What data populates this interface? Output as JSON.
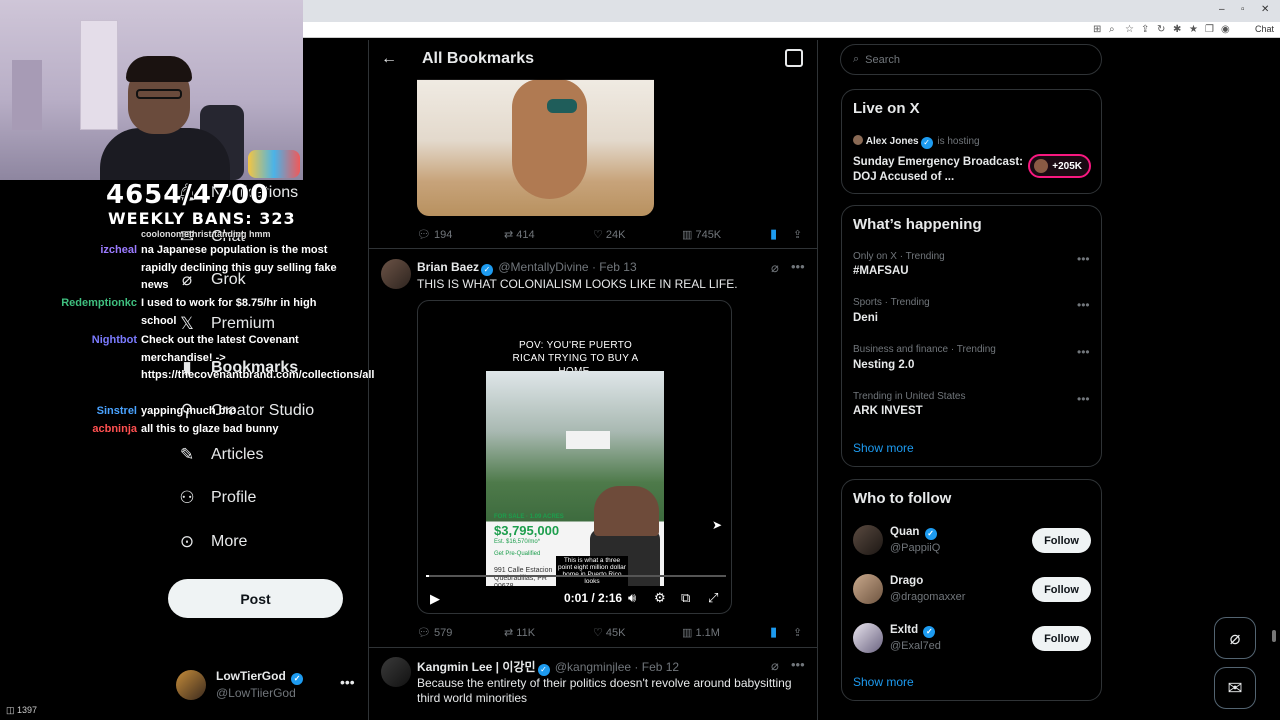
{
  "overlay": {
    "counter": "4654/4700",
    "weekly_bans": "WEEKLY BANS: 323",
    "viewers": "1397"
  },
  "nav": {
    "items": [
      {
        "label": "Notifications",
        "icon": "bell-icon"
      },
      {
        "label": "Chat",
        "icon": "chat-icon"
      },
      {
        "label": "Grok",
        "icon": "grok-icon"
      },
      {
        "label": "Premium",
        "icon": "x-logo-icon"
      },
      {
        "label": "Bookmarks",
        "icon": "bookmark-icon"
      },
      {
        "label": "Creator Studio",
        "icon": "creator-studio-icon"
      },
      {
        "label": "Articles",
        "icon": "article-icon"
      },
      {
        "label": "Profile",
        "icon": "profile-icon"
      },
      {
        "label": "More",
        "icon": "more-circle-icon"
      }
    ],
    "post_label": "Post",
    "account": {
      "name": "LowTierGod",
      "handle": "@LowTiierGod"
    }
  },
  "chat": [
    {
      "user": "",
      "user_color": "#e05555",
      "msg": "coolonomethrist tanding hmm"
    },
    {
      "user": "izcheal",
      "user_color": "#9b7bff",
      "msg": "na Japanese population is the most rapidly declining this guy selling fake news"
    },
    {
      "user": "Redemptionkc",
      "user_color": "#3fbf7f",
      "msg": "I used to work for $8.75/hr in high school"
    },
    {
      "user": "Nightbot",
      "user_color": "#7b7bff",
      "msg": "Check out the latest Covenant merchandise! -> https://thecovenantbrand.com/collections/all"
    },
    {
      "user": "Sinstrel",
      "user_color": "#4aa3ff",
      "msg": "yapping much bro"
    },
    {
      "user": "acbninja",
      "user_color": "#ff5050",
      "msg": "all this to glaze bad bunny"
    }
  ],
  "middle": {
    "title": "All Bookmarks",
    "tweet1_stats": {
      "replies": "194",
      "reposts": "414",
      "likes": "24K",
      "views": "745K"
    },
    "tweet2": {
      "name": "Brian Baez",
      "handle": "@MentallyDivine",
      "date": "Feb 13",
      "text": "THIS IS WHAT COLONIALISM LOOKS LIKE IN REAL LIFE.",
      "video": {
        "caption": "POV: YOU'RE PUERTO RICAN TRYING TO BUY A HOME.",
        "for_sale": "FOR SALE · 1.09 ACRES",
        "price": "$3,795,000",
        "est": "Est. $16,570/mo*",
        "prequal": "Get Pre-Qualified",
        "address": "991 Calle Estacion Quebradillas, PR 00678",
        "subtitle": "This is what a three point eight million dollar home in Puerto Rico looks",
        "time": "0:01 / 2:16",
        "progress": 0.01
      },
      "stats": {
        "replies": "579",
        "reposts": "11K",
        "likes": "45K",
        "views": "1.1M"
      }
    },
    "tweet3": {
      "name": "Kangmin Lee | 이강민",
      "handle": "@kangminjlee",
      "date": "Feb 12",
      "text": "Because the entirety of their politics doesn't revolve around babysitting third world minorities"
    }
  },
  "right": {
    "search_placeholder": "Search",
    "live": {
      "title": "Live on X",
      "host": "Alex Jones",
      "hosting": "is hosting",
      "event": "Sunday Emergency Broadcast: DOJ Accused of ...",
      "listeners": "+205K"
    },
    "happening": {
      "title": "What’s happening",
      "trends": [
        {
          "context": "Only on X · Trending",
          "topic": "#MAFSAU"
        },
        {
          "context": "Sports · Trending",
          "topic": "Deni"
        },
        {
          "context": "Business and finance · Trending",
          "topic": "Nesting 2.0"
        },
        {
          "context": "Trending in United States",
          "topic": "ARK INVEST"
        }
      ],
      "show_more": "Show more"
    },
    "who_to_follow": {
      "title": "Who to follow",
      "accounts": [
        {
          "name": "Quan",
          "handle": "@PappiiQ",
          "follow": "Follow"
        },
        {
          "name": "Drago",
          "handle": "@dragomaxxer",
          "follow": "Follow"
        },
        {
          "name": "Exltd",
          "handle": "@Exal7ed",
          "follow": "Follow"
        }
      ],
      "show_more": "Show more"
    }
  },
  "browser": {
    "chat_label": "Chat"
  },
  "colors": {
    "accent": "#1d9bf0",
    "live": "#f91880",
    "bg": "#000000"
  }
}
